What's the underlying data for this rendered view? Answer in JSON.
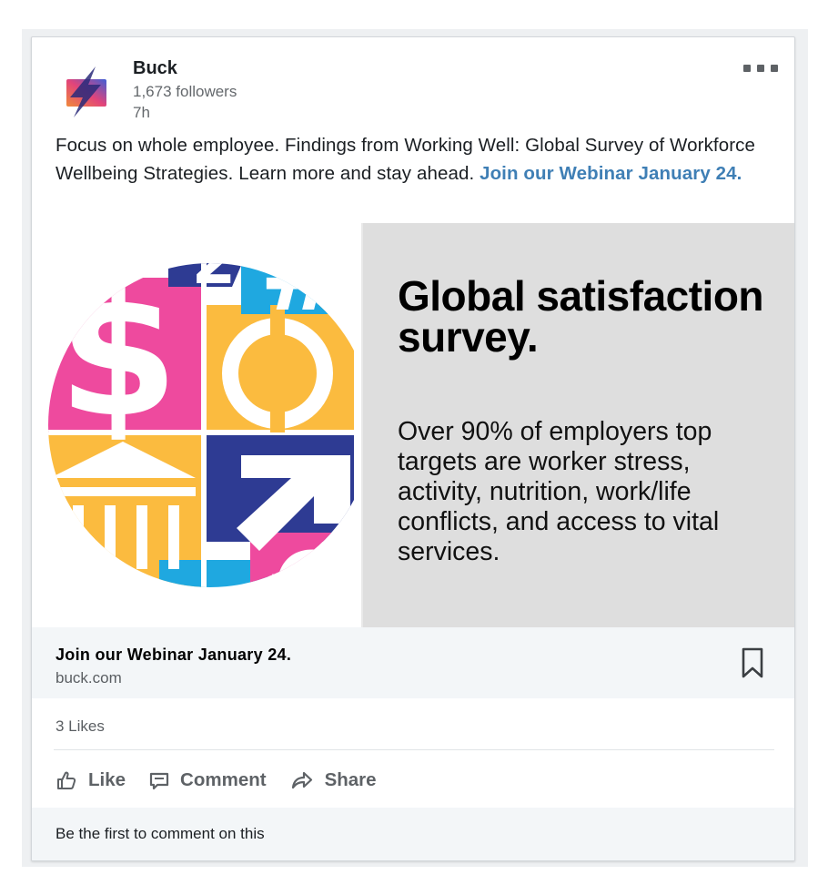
{
  "post": {
    "author": "Buck",
    "followers": "1,673 followers",
    "time": "7h",
    "text": "Focus on whole employee. Findings from Working Well: Global Survey of Workforce Wellbeing Strategies. Learn more and stay ahead.",
    "link_text": "Join our Webinar January 24."
  },
  "hero": {
    "title": "Global satisfaction survey.",
    "description": "Over 90% of employers top targets are worker stress, activity, nutrition, work/life conflicts, and access to vital services.",
    "colors": {
      "pink": "#ee4a9e",
      "yellow": "#fbbb3f",
      "blue": "#2e3b93",
      "cyan": "#1fa8e0",
      "panel": "#dedede"
    }
  },
  "link_preview": {
    "title": "Join our Webinar January 24.",
    "domain": "buck.com"
  },
  "social": {
    "likes": "3 Likes",
    "actions": {
      "like": "Like",
      "comment": "Comment",
      "share": "Share"
    },
    "comment_prompt": "Be the first to comment on this"
  },
  "brand": {
    "accent": "#3f7fb5"
  }
}
